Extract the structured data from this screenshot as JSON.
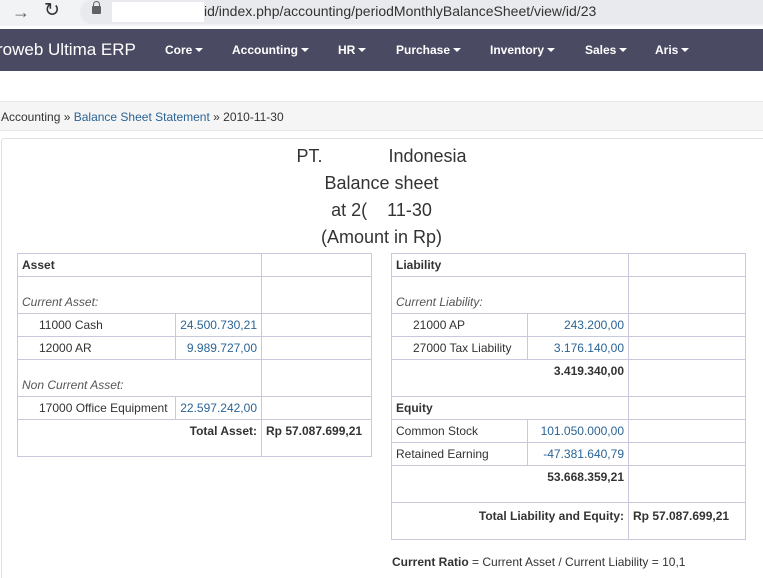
{
  "browser": {
    "url_visible": "id/index.php/accounting/periodMonthlyBalanceSheet/view/id/23"
  },
  "navbar": {
    "brand": "roweb Ultima ERP",
    "menus": [
      "Core",
      "Accounting",
      "HR",
      "Purchase",
      "Inventory",
      "Sales",
      "Aris"
    ]
  },
  "breadcrumb": {
    "root": "Accounting",
    "sep1": " » ",
    "link": "Balance Sheet Statement",
    "sep2": " » ",
    "current": "2010-11-30"
  },
  "header": {
    "company_left": "PT.",
    "company_right": "Indonesia",
    "title": "Balance sheet",
    "date_left": "at 2(",
    "date_right": "11-30",
    "unit": "(Amount in Rp)"
  },
  "assets": {
    "heading": "Asset",
    "current_label": "Current Asset:",
    "current_items": [
      {
        "account": "11000 Cash",
        "amount": "24.500.730,21"
      },
      {
        "account": "12000 AR",
        "amount": "9.989.727,00"
      }
    ],
    "noncurrent_label": "Non Current Asset:",
    "noncurrent_items": [
      {
        "account": "17000 Office Equipment",
        "amount": "22.597.242,00"
      }
    ],
    "total_label": "Total Asset:",
    "total_value": "Rp 57.087.699,21"
  },
  "liabilities": {
    "heading": "Liability",
    "current_label": "Current Liability:",
    "items": [
      {
        "account": "21000 AP",
        "amount": "243.200,00"
      },
      {
        "account": "27000 Tax Liability",
        "amount": "3.176.140,00"
      }
    ],
    "subtotal": "3.419.340,00"
  },
  "equity": {
    "heading": "Equity",
    "items": [
      {
        "account": "Common Stock",
        "amount": "101.050.000,00"
      },
      {
        "account": "Retained Earning",
        "amount": "-47.381.640,79"
      }
    ],
    "subtotal": "53.668.359,21",
    "total_label": "Total Liability and Equity:",
    "total_value": "Rp 57.087.699,21"
  },
  "ratio": {
    "label": "Current Ratio",
    "formula": " = Current Asset / Current Liability = 10,1"
  }
}
